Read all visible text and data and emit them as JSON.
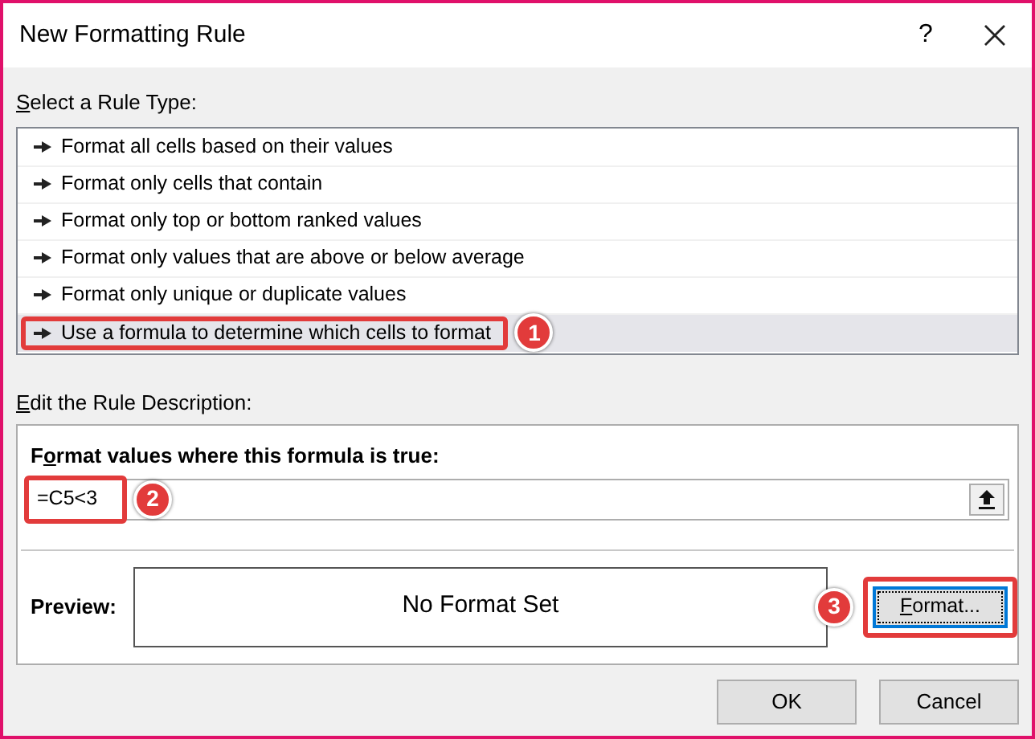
{
  "window": {
    "title": "New Formatting Rule",
    "help": "?"
  },
  "rule_type_label": {
    "access_key": "S",
    "rest": "elect a Rule Type:"
  },
  "rule_types": [
    {
      "label": "Format all cells based on their values",
      "selected": false
    },
    {
      "label": "Format only cells that contain",
      "selected": false
    },
    {
      "label": "Format only top or bottom ranked values",
      "selected": false
    },
    {
      "label": "Format only values that are above or below average",
      "selected": false
    },
    {
      "label": "Format only unique or duplicate values",
      "selected": false
    },
    {
      "label": "Use a formula to determine which cells to format",
      "selected": true,
      "callout": "1"
    }
  ],
  "description_label": {
    "access_key": "E",
    "rest": "dit the Rule Description:"
  },
  "formula": {
    "label": {
      "before": "F",
      "access_key": "o",
      "rest": "rmat values where this formula is true:"
    },
    "value": "=C5<3",
    "callout": "2"
  },
  "preview": {
    "label": "Preview:",
    "text": "No Format Set"
  },
  "format_button": {
    "label": {
      "access_key": "F",
      "rest": "ormat..."
    },
    "callout": "3"
  },
  "buttons": [
    "OK",
    "Cancel"
  ]
}
